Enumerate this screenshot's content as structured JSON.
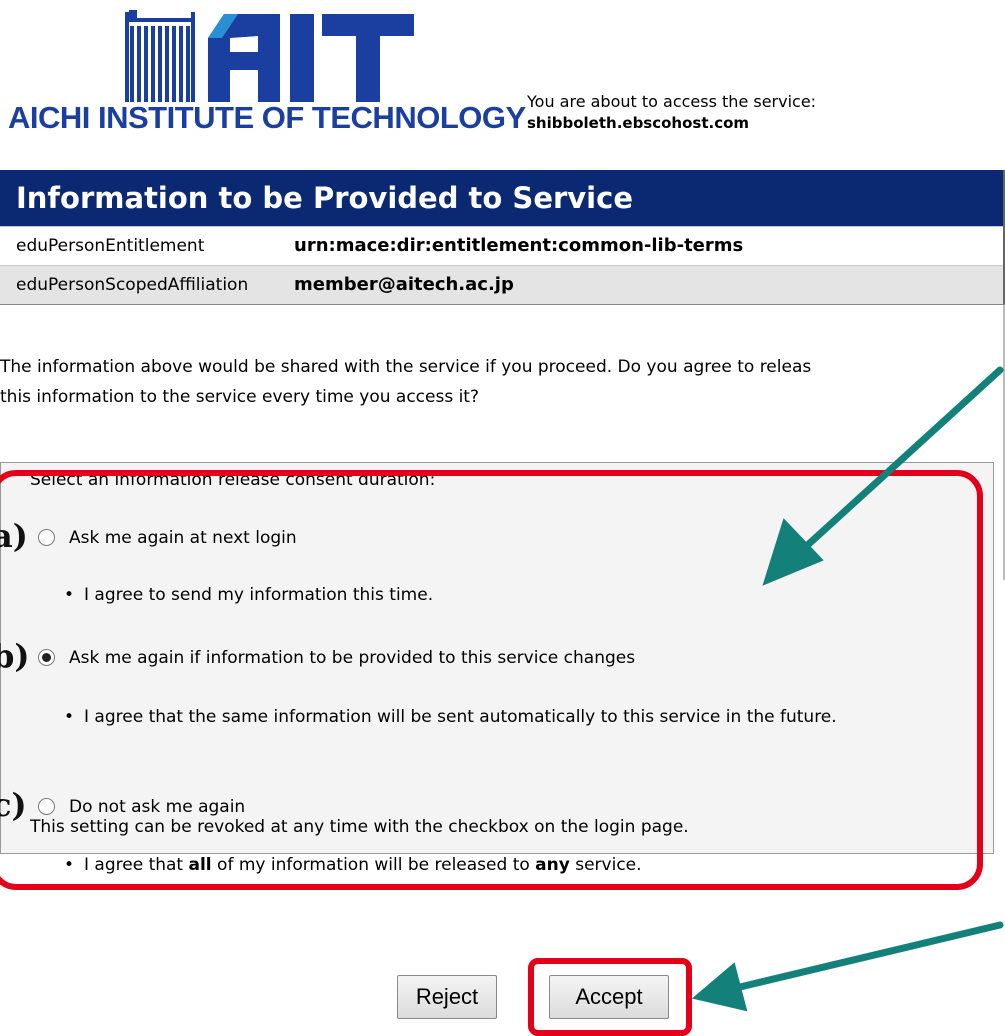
{
  "logo": {
    "brand": "AIT",
    "caption": "AICHI INSTITUTE OF TECHNOLOGY",
    "color": "#1a3fa0",
    "accent": "#2b8fd6"
  },
  "service": {
    "intro": "You are about to access the service:",
    "name": "shibboleth.ebscohost.com"
  },
  "attributes": {
    "header": "Information to be Provided to Service",
    "header_color": "#0b2973",
    "rows": [
      {
        "name": "eduPersonEntitlement",
        "value": "urn:mace:dir:entitlement:common-lib-terms"
      },
      {
        "name": "eduPersonScopedAffiliation",
        "value": "member@aitech.ac.jp"
      }
    ]
  },
  "intro_text": {
    "line1": "The information above would be shared with the service if you proceed. Do you agree to releas",
    "line2": "this information to the service every time you access it?"
  },
  "consent": {
    "title": "Select an information release consent duration:",
    "options": [
      {
        "marker": "a)",
        "label": "Ask me again at next login",
        "selected": false,
        "note": "I agree to send my information this time."
      },
      {
        "marker": "b)",
        "label": "Ask me again if information to be provided to this service changes",
        "selected": true,
        "note": "I agree that the same information will be sent automatically to this service in the future."
      },
      {
        "marker": "c)",
        "label": "Do not ask me again",
        "selected": false,
        "note_parts": [
          "I agree that ",
          "all",
          " of my information will be released to ",
          "any",
          " service."
        ]
      }
    ],
    "footer": "This setting can be revoked at any time with the checkbox on the login page."
  },
  "buttons": {
    "reject": "Reject",
    "accept": "Accept"
  },
  "colors": {
    "highlight": "#e4001b",
    "arrow": "#14807a"
  }
}
